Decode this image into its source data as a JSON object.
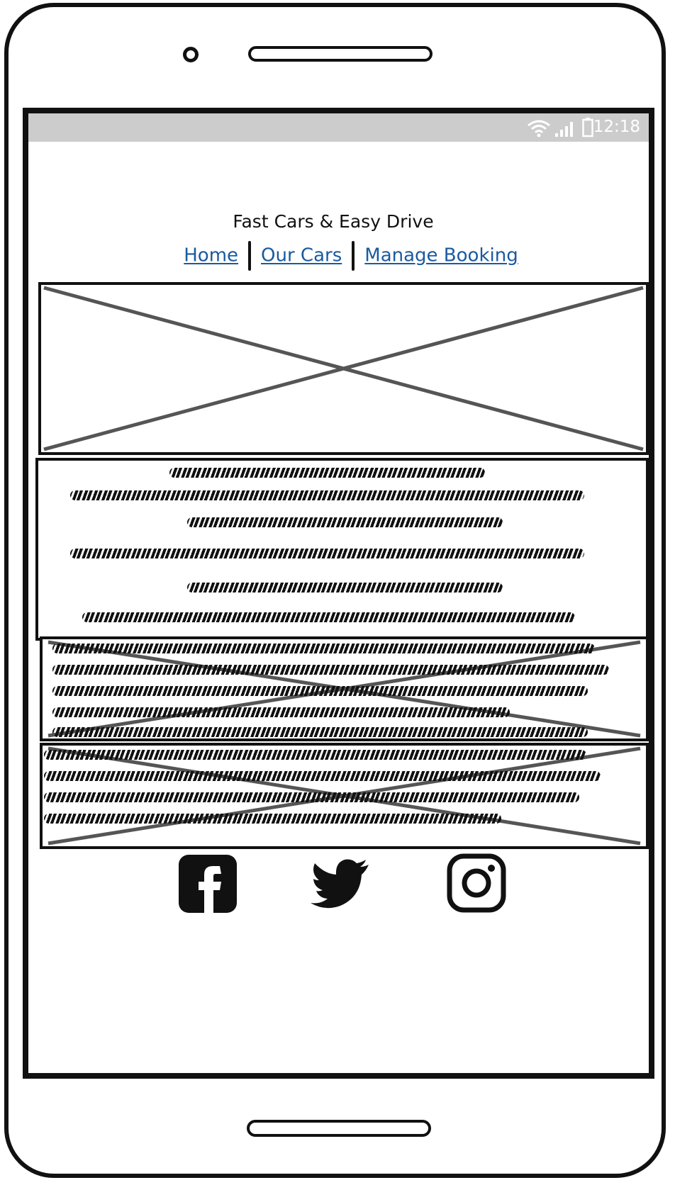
{
  "status_bar": {
    "time": "12:18",
    "icons": [
      "wifi-icon",
      "signal-icon",
      "battery-icon"
    ]
  },
  "header": {
    "title": "Fast Cars & Easy Drive"
  },
  "nav": {
    "items": [
      {
        "label": "Home"
      },
      {
        "label": "Our Cars"
      },
      {
        "label": "Manage Booking"
      }
    ]
  },
  "hero": {
    "type": "image-placeholder"
  },
  "text_block": {
    "lines": 6
  },
  "card_1": {
    "type": "image-placeholder-with-text"
  },
  "card_2": {
    "type": "image-placeholder-with-text"
  },
  "social": {
    "icons": [
      "facebook-icon",
      "twitter-icon",
      "instagram-icon"
    ]
  },
  "colors": {
    "link": "#1a5aa0",
    "status_bar": "#cccccc",
    "outline": "#111111"
  }
}
